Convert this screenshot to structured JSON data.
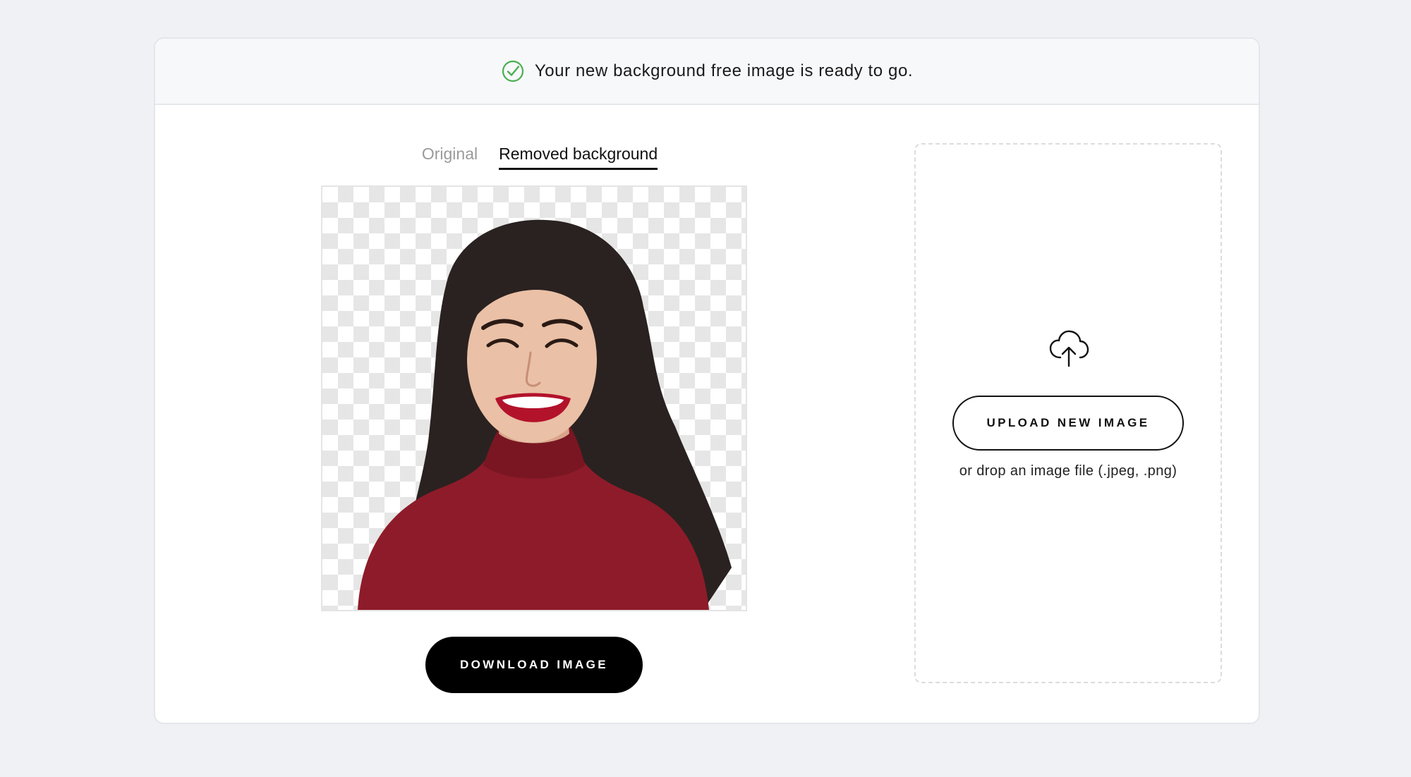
{
  "banner": {
    "message": "Your new background free image is ready to go.",
    "icon": "check-circle-icon",
    "icon_color": "#4caf50"
  },
  "tabs": [
    {
      "label": "Original",
      "active": false
    },
    {
      "label": "Removed background",
      "active": true
    }
  ],
  "preview": {
    "background": "transparent-checkerboard",
    "subject": "smiling woman with dark wavy hair in red turtleneck"
  },
  "actions": {
    "download_label": "DOWNLOAD IMAGE"
  },
  "upload": {
    "icon": "cloud-upload-icon",
    "button_label": "UPLOAD NEW IMAGE",
    "hint": "or drop an image file (.jpeg, .png)"
  },
  "colors": {
    "page_bg": "#eff1f5",
    "card_bg": "#ffffff",
    "primary_button": "#000000",
    "sweater": "#8e1b2a"
  }
}
